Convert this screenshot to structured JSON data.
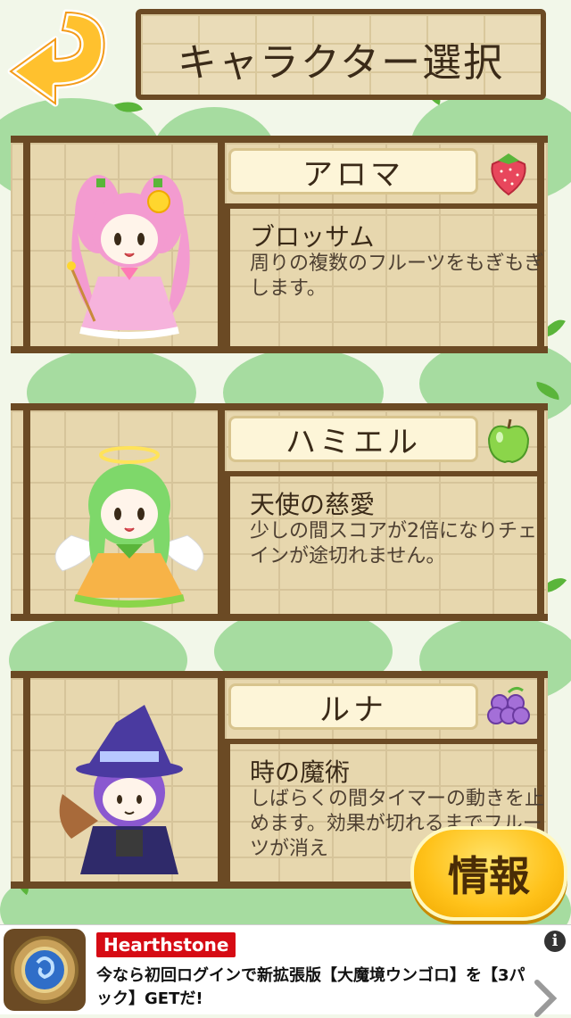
{
  "title": "キャラクター選択",
  "icons": {
    "back": "back-arrow-icon",
    "info_button_shape": "rounded-yellow-pill"
  },
  "characters": [
    {
      "name": "アロマ",
      "skill_name": "ブロッサム",
      "skill_desc": "周りの複数のフルーツをもぎもぎします。",
      "fruit": "strawberry-icon",
      "fruit_color": "#e8475c",
      "hair_color": "#f39bd0"
    },
    {
      "name": "ハミエル",
      "skill_name": "天使の慈愛",
      "skill_desc": "少しの間スコアが2倍になりチェインが途切れません。",
      "fruit": "apple-icon",
      "fruit_color": "#8bd54a",
      "hair_color": "#7ed86a"
    },
    {
      "name": "ルナ",
      "skill_name": "時の魔術",
      "skill_desc": "しばらくの間タイマーの動きを止めます。効果が切れるまでフルーツが消え",
      "fruit": "grape-icon",
      "fruit_color": "#a46fd8",
      "hair_color": "#8a58d0"
    }
  ],
  "info_button": "情報",
  "ad": {
    "brand": "Hearthstone",
    "text": "今なら初回ログインで新拡張版【大魔境ウンゴロ】を【3パック】GETだ!",
    "info_glyph": "i"
  },
  "colors": {
    "wood_frame": "#6b4a24",
    "board": "#e7d7ae",
    "background_trees": "#a6dca0",
    "button": "#ffc21a"
  }
}
